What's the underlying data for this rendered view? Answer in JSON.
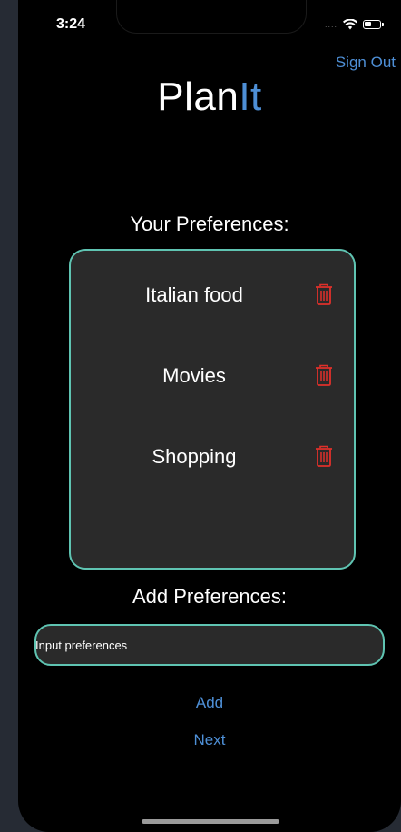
{
  "status_bar": {
    "time": "3:24",
    "signal": "....",
    "icons": [
      "wifi-icon",
      "battery-icon"
    ]
  },
  "header": {
    "sign_out_label": "Sign Out",
    "title_part1": "Plan",
    "title_part2": "It"
  },
  "preferences": {
    "heading": "Your Preferences:",
    "items": [
      {
        "label": "Italian food",
        "icon": "trash-icon"
      },
      {
        "label": "Movies",
        "icon": "trash-icon"
      },
      {
        "label": "Shopping",
        "icon": "trash-icon"
      }
    ]
  },
  "add_section": {
    "heading": "Add Preferences:",
    "input_placeholder": "Input preferences",
    "input_value": "",
    "add_label": "Add",
    "next_label": "Next"
  },
  "colors": {
    "accent": "#4e8fd6",
    "border": "#5fc4b2",
    "delete": "#e0302a",
    "background": "#000000",
    "card": "#2a2a2a"
  }
}
